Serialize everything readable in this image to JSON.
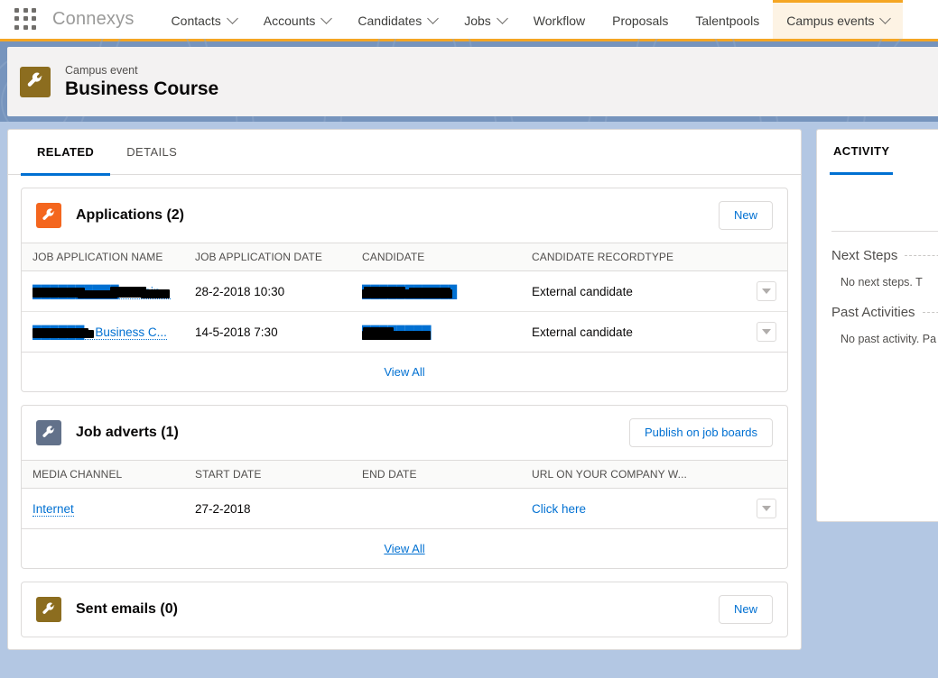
{
  "topbar": {
    "app_launcher_icon": "app-grid-icon",
    "brand": "Connexys",
    "nav": [
      {
        "label": "Contacts",
        "has_caret": true,
        "active": false
      },
      {
        "label": "Accounts",
        "has_caret": true,
        "active": false
      },
      {
        "label": "Candidates",
        "has_caret": true,
        "active": false
      },
      {
        "label": "Jobs",
        "has_caret": true,
        "active": false
      },
      {
        "label": "Workflow",
        "has_caret": false,
        "active": false
      },
      {
        "label": "Proposals",
        "has_caret": false,
        "active": false
      },
      {
        "label": "Talentpools",
        "has_caret": false,
        "active": false
      },
      {
        "label": "Campus events",
        "has_caret": true,
        "active": true
      }
    ]
  },
  "record_header": {
    "icon": "wrench-icon",
    "icon_color": "#8c6d1f",
    "kicker": "Campus event",
    "title": "Business Course"
  },
  "tabs": [
    {
      "label": "RELATED",
      "active": true
    },
    {
      "label": "DETAILS",
      "active": false
    }
  ],
  "panels": [
    {
      "id": "applications",
      "icon": "wrench-icon",
      "icon_color": "#f4661e",
      "title": "Applications (2)",
      "action_label": "New",
      "columns": [
        "JOB APPLICATION NAME",
        "JOB APPLICATION DATE",
        "CANDIDATE",
        "CANDIDATE RECORDTYPE"
      ],
      "rows": [
        {
          "name": "██████████ - Busin...",
          "name_redacted": true,
          "date": "28-2-2018 10:30",
          "candidate": "███████████",
          "candidate_redacted": true,
          "recordtype": "External candidate",
          "menu_icon": "chevron-down-icon"
        },
        {
          "name": "██████ - Business C...",
          "name_redacted": true,
          "date": "14-5-2018 7:30",
          "candidate": "████████",
          "candidate_redacted": true,
          "recordtype": "External candidate",
          "menu_icon": "chevron-down-icon"
        }
      ],
      "view_all": "View All",
      "view_all_underlined": false
    },
    {
      "id": "job-adverts",
      "icon": "wrench-icon",
      "icon_color": "#62718a",
      "title": "Job adverts (1)",
      "action_label": "Publish on job boards",
      "columns": [
        "MEDIA CHANNEL",
        "START DATE",
        "END DATE",
        "URL ON YOUR COMPANY W..."
      ],
      "rows": [
        {
          "media_channel": "Internet",
          "start_date": "27-2-2018",
          "end_date": "",
          "url_label": "Click here",
          "menu_icon": "chevron-down-icon"
        }
      ],
      "view_all": "View All",
      "view_all_underlined": true
    },
    {
      "id": "sent-emails",
      "icon": "wrench-icon",
      "icon_color": "#8c6d1f",
      "title": "Sent emails (0)",
      "action_label": "New"
    }
  ],
  "activity": {
    "tab_label": "ACTIVITY",
    "next_steps_title": "Next Steps",
    "next_steps_body": "No next steps. T",
    "past_activities_title": "Past Activities",
    "past_activities_body": "No past activity. Pa"
  },
  "colors": {
    "page_background": "#b3c7e3",
    "band": "#7694bd",
    "accent_orange": "#f5a623",
    "link_blue": "#0070d2",
    "active_tab_blue": "#0070d2"
  }
}
